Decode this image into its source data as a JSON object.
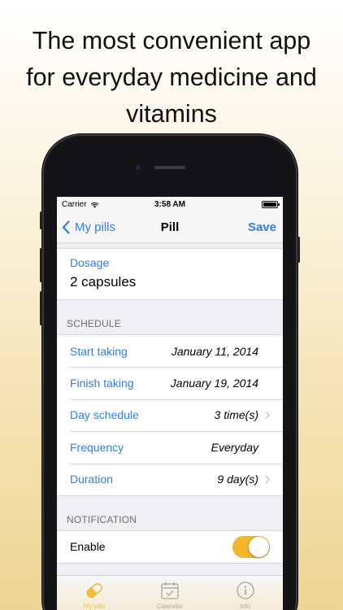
{
  "headline": {
    "line1": "The most convenient app",
    "line2": "for everyday medicine and",
    "line3": "vitamins"
  },
  "status_bar": {
    "carrier": "Carrier",
    "time": "3:58 AM"
  },
  "nav": {
    "back_label": "My pills",
    "title": "Pill",
    "save_label": "Save"
  },
  "dosage": {
    "label": "Dosage",
    "value": "2 capsules"
  },
  "schedule": {
    "header": "SCHEDULE",
    "start": {
      "label": "Start taking",
      "value": "January 11, 2014"
    },
    "finish": {
      "label": "Finish taking",
      "value": "January 19, 2014"
    },
    "day_schedule": {
      "label": "Day schedule",
      "value": "3 time(s)"
    },
    "frequency": {
      "label": "Frequency",
      "value": "Everyday"
    },
    "duration": {
      "label": "Duration",
      "value": "9 day(s)"
    }
  },
  "notification": {
    "header": "NOTIFICATION",
    "enable_label": "Enable",
    "enabled": true
  },
  "tabs": [
    {
      "label": "My pills",
      "icon": "pill-icon",
      "active": true
    },
    {
      "label": "Calendar",
      "icon": "calendar-icon",
      "active": false
    },
    {
      "label": "Info",
      "icon": "info-icon",
      "active": false
    }
  ],
  "colors": {
    "accent_blue": "#2f7ee8",
    "toggle_on": "#f2b72c",
    "background_gradient_end": "#efd595"
  }
}
